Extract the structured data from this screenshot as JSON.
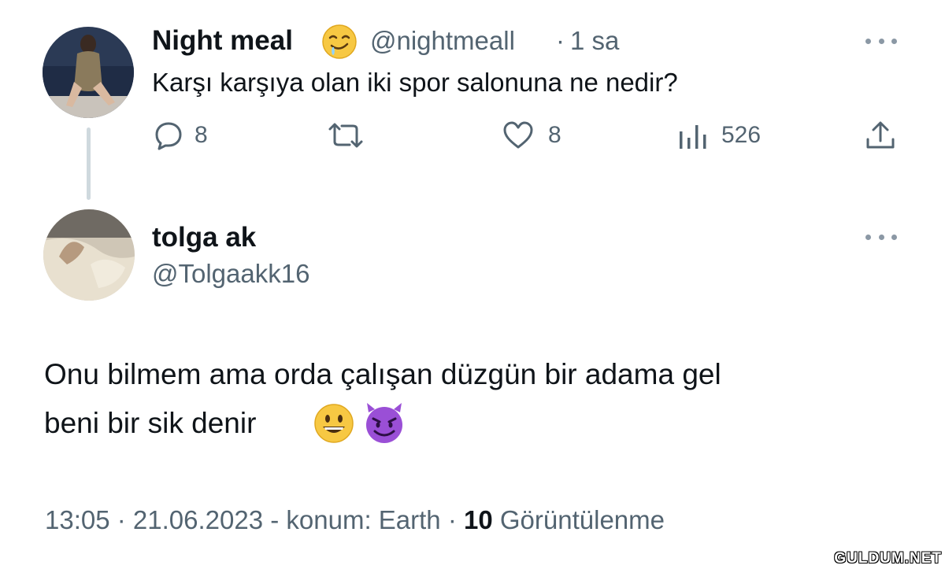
{
  "tweet1": {
    "name": "Night meal",
    "handle": "@nightmeall",
    "separator": "·",
    "time": "1 sa",
    "text": "Karşı karşıya olan iki spor salonuna ne nedir?",
    "replies": "8",
    "likes": "8",
    "views": "526"
  },
  "tweet2": {
    "name": "tolga ak",
    "handle": "@Tolgaakk16",
    "text_line1": "Onu bilmem ama orda çalışan düzgün bir adama gel",
    "text_line2": "beni bir sik denir",
    "timestamp": "13:05 · 21.06.2023 - konum: Earth · ",
    "views_count": "10",
    "views_label": "Görüntülenme"
  },
  "watermark": "GULDUM.NET",
  "icons": {
    "reply": "speech-bubble-icon",
    "retweet": "retweet-icon",
    "like": "heart-icon",
    "views": "bar-chart-icon",
    "share": "share-upload-icon",
    "more": "more-dots-icon",
    "emoji_name": "drooling-face-emoji",
    "emoji_body1": "grinning-face-emoji",
    "emoji_body2": "smiling-devil-emoji"
  },
  "colors": {
    "text_primary": "#0f1419",
    "text_secondary": "#536471",
    "thread_line": "#cfd9de"
  }
}
